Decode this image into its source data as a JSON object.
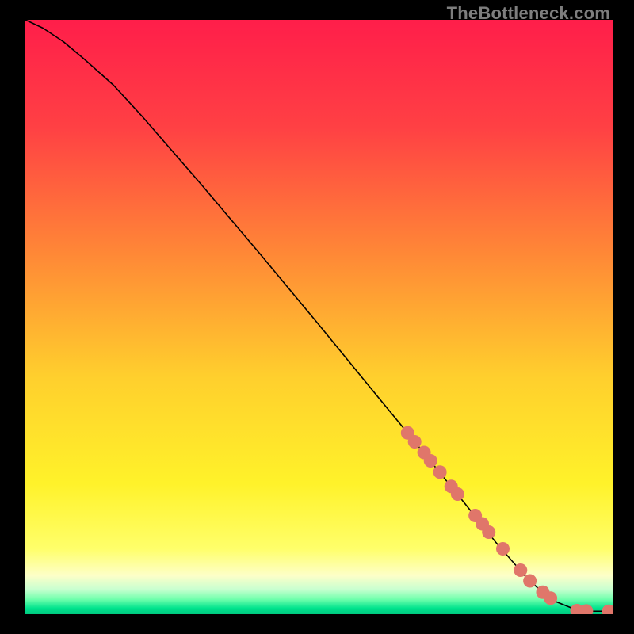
{
  "watermark": "TheBottleneck.com",
  "chart_data": {
    "type": "line",
    "xlabel": "",
    "ylabel": "",
    "xlim": [
      0,
      100
    ],
    "ylim": [
      0,
      100
    ],
    "title": "",
    "gradient_stops": [
      {
        "offset": 0.0,
        "color": "#ff1e4a"
      },
      {
        "offset": 0.18,
        "color": "#ff4044"
      },
      {
        "offset": 0.4,
        "color": "#ff8a36"
      },
      {
        "offset": 0.6,
        "color": "#ffcf2d"
      },
      {
        "offset": 0.78,
        "color": "#fff22a"
      },
      {
        "offset": 0.89,
        "color": "#ffff6a"
      },
      {
        "offset": 0.935,
        "color": "#fdffc8"
      },
      {
        "offset": 0.958,
        "color": "#c9ffd0"
      },
      {
        "offset": 0.975,
        "color": "#6fffac"
      },
      {
        "offset": 0.99,
        "color": "#00e38d"
      },
      {
        "offset": 1.0,
        "color": "#00c97f"
      }
    ],
    "series": [
      {
        "name": "curve",
        "x": [
          0,
          3,
          6.5,
          10,
          15,
          20,
          30,
          40,
          50,
          60,
          65,
          70,
          75,
          80,
          85,
          88,
          90,
          93,
          96,
          100
        ],
        "y": [
          100,
          98.6,
          96.3,
          93.4,
          89.0,
          83.6,
          72.2,
          60.5,
          48.6,
          36.5,
          30.5,
          24.4,
          18.3,
          12.1,
          6.4,
          3.6,
          2.2,
          1.0,
          0.5,
          0.5
        ]
      }
    ],
    "markers": {
      "name": "dots",
      "color": "#e0766a",
      "radius_px": 8.5,
      "x": [
        65,
        66.2,
        67.8,
        68.9,
        70.5,
        72.4,
        73.5,
        76.5,
        77.7,
        78.8,
        81.2,
        84.2,
        85.8,
        88.0,
        89.3,
        93.8,
        95.4,
        99.2,
        100.5
      ],
      "y": [
        30.5,
        29.0,
        27.2,
        25.8,
        23.9,
        21.5,
        20.2,
        16.6,
        15.2,
        13.8,
        11.0,
        7.4,
        5.6,
        3.7,
        2.7,
        0.6,
        0.55,
        0.5,
        0.5
      ]
    }
  }
}
